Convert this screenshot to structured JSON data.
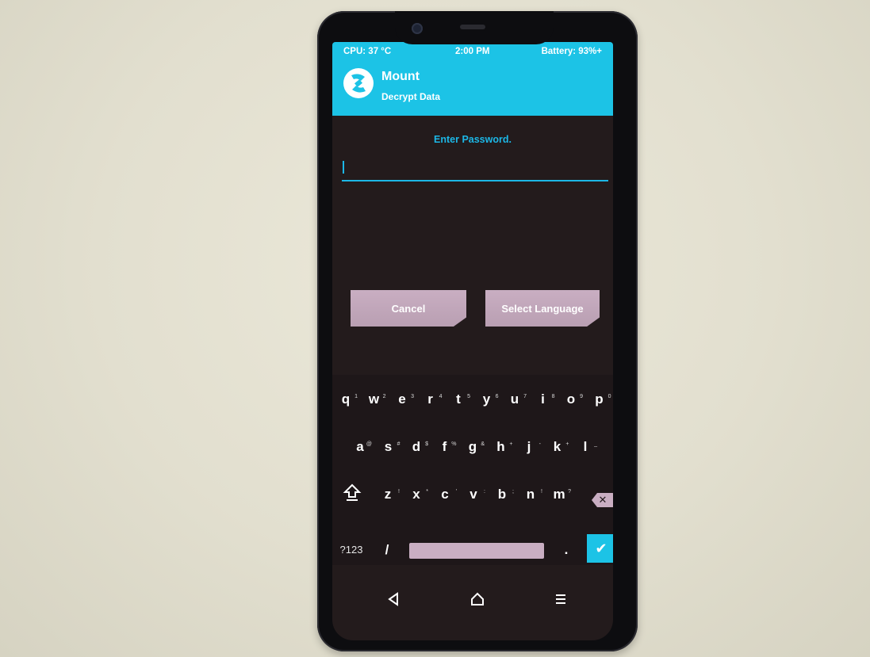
{
  "status_bar": {
    "cpu": "CPU: 37 °C",
    "time": "2:00 PM",
    "battery": "Battery: 93%+"
  },
  "header": {
    "title": "Mount",
    "subtitle": "Decrypt Data"
  },
  "password": {
    "prompt": "Enter Password.",
    "value": ""
  },
  "buttons": {
    "cancel": "Cancel",
    "select_language": "Select Language"
  },
  "keyboard": {
    "row1": [
      {
        "key": "q",
        "hint": "1"
      },
      {
        "key": "w",
        "hint": "2"
      },
      {
        "key": "e",
        "hint": "3"
      },
      {
        "key": "r",
        "hint": "4"
      },
      {
        "key": "t",
        "hint": "5"
      },
      {
        "key": "y",
        "hint": "6"
      },
      {
        "key": "u",
        "hint": "7"
      },
      {
        "key": "i",
        "hint": "8"
      },
      {
        "key": "o",
        "hint": "9"
      },
      {
        "key": "p",
        "hint": "0"
      }
    ],
    "row2": [
      {
        "key": "a",
        "hint": "@"
      },
      {
        "key": "s",
        "hint": "#"
      },
      {
        "key": "d",
        "hint": "$"
      },
      {
        "key": "f",
        "hint": "%"
      },
      {
        "key": "g",
        "hint": "&"
      },
      {
        "key": "h",
        "hint": "+"
      },
      {
        "key": "j",
        "hint": "-"
      },
      {
        "key": "k",
        "hint": "+"
      },
      {
        "key": "l",
        "hint": "_"
      }
    ],
    "row3": [
      {
        "key": "z",
        "hint": "!"
      },
      {
        "key": "x",
        "hint": "*"
      },
      {
        "key": "c",
        "hint": "'"
      },
      {
        "key": "v",
        "hint": ":"
      },
      {
        "key": "b",
        "hint": ";"
      },
      {
        "key": "n",
        "hint": "!"
      },
      {
        "key": "m",
        "hint": "?"
      }
    ],
    "symbols_label": "?123",
    "slash": "/",
    "period": ".",
    "shift_icon": "shift-icon",
    "backspace_icon": "backspace-icon",
    "enter_icon": "checkmark-icon"
  },
  "navbar": {
    "back_icon": "back-triangle-icon",
    "home_icon": "home-icon",
    "menu_icon": "menu-icon"
  },
  "colors": {
    "accent": "#1cc3e6",
    "button": "#c9aec2",
    "background": "#231b1c"
  }
}
